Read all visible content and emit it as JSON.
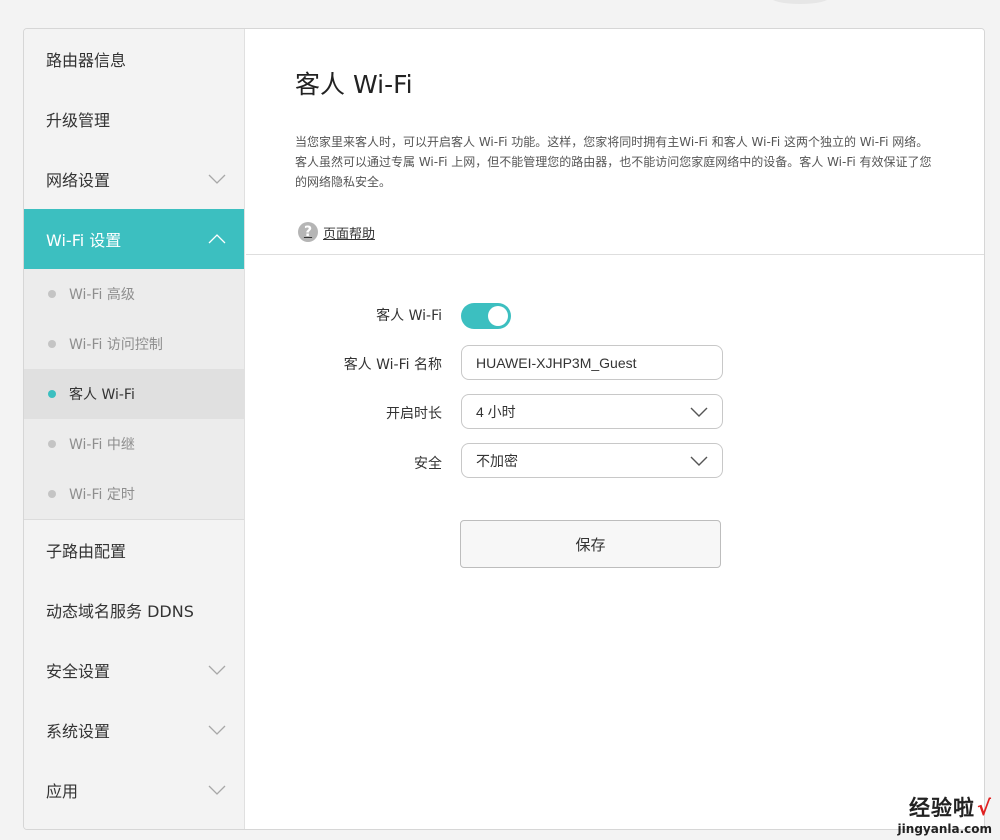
{
  "sidebar": {
    "items": [
      {
        "label": "路由器信息"
      },
      {
        "label": "升级管理"
      },
      {
        "label": "网络设置"
      },
      {
        "label": "Wi-Fi 设置"
      }
    ],
    "wifi_sub_items": [
      {
        "label": "Wi-Fi 高级"
      },
      {
        "label": "Wi-Fi 访问控制"
      },
      {
        "label": "客人 Wi-Fi"
      },
      {
        "label": "Wi-Fi 中继"
      },
      {
        "label": "Wi-Fi 定时"
      }
    ],
    "items_after": [
      {
        "label": "子路由配置"
      },
      {
        "label": "动态域名服务 DDNS"
      },
      {
        "label": "安全设置"
      },
      {
        "label": "系统设置"
      },
      {
        "label": "应用"
      }
    ]
  },
  "main": {
    "title": "客人 Wi-Fi",
    "description": "当您家里来客人时，可以开启客人 Wi-Fi 功能。这样，您家将同时拥有主Wi-Fi 和客人 Wi-Fi 这两个独立的 Wi-Fi 网络。客人虽然可以通过专属 Wi-Fi 上网，但不能管理您的路由器，也不能访问您家庭网络中的设备。客人 Wi-Fi 有效保证了您的网络隐私安全。",
    "help_icon_glyph": "?",
    "help_label": "页面帮助"
  },
  "form": {
    "guest_wifi_label": "客人 Wi-Fi",
    "guest_wifi_enabled": true,
    "name_label": "客人 Wi-Fi 名称",
    "name_value": "HUAWEI-XJHP3M_Guest",
    "duration_label": "开启时长",
    "duration_value": "4 小时",
    "security_label": "安全",
    "security_value": "不加密",
    "save_label": "保存"
  },
  "watermark": {
    "text": "经验啦",
    "check": "√",
    "url": "jingyanla.com"
  },
  "colors": {
    "accent": "#3cbfc0",
    "sidebar_bg": "#f3f3f3"
  }
}
